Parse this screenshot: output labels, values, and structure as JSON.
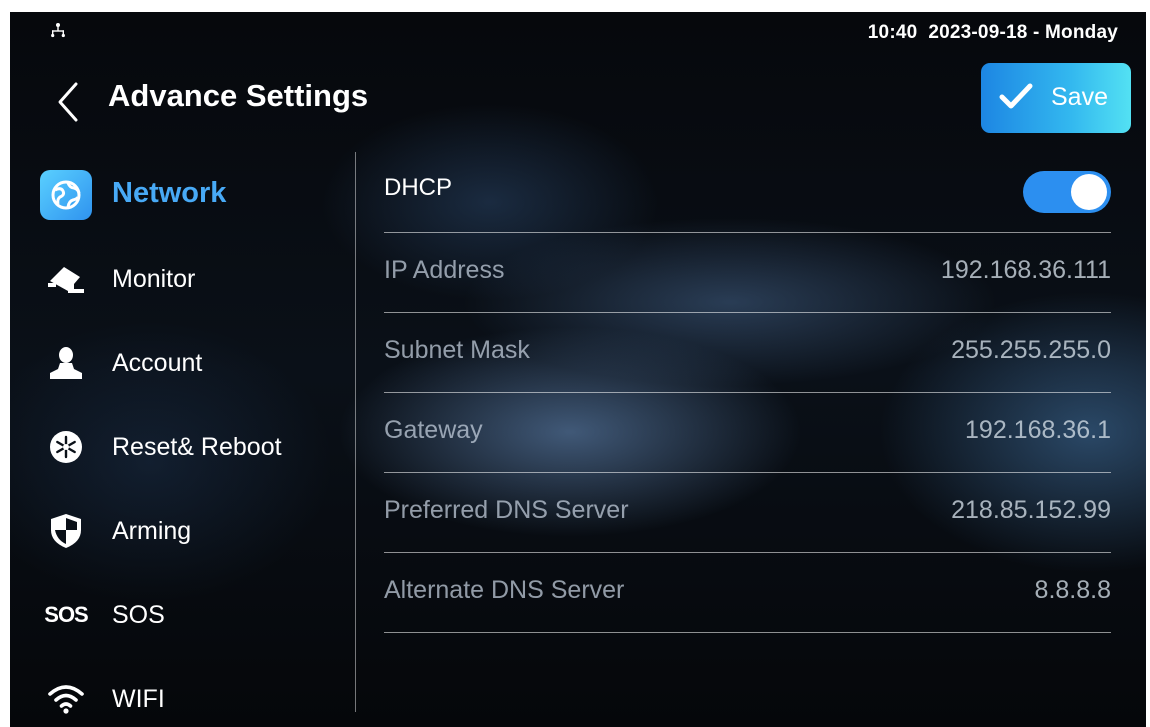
{
  "status_bar": {
    "clock": "10:40  2023-09-18 - Monday",
    "network_icon": "network-tree-icon"
  },
  "header": {
    "back_icon": "chevron-left-icon",
    "title": "Advance Settings",
    "save_label": "Save",
    "save_icon": "checkmark-icon"
  },
  "sidebar": {
    "items": [
      {
        "label": "Network",
        "icon": "network-globe-icon",
        "active": true
      },
      {
        "label": "Monitor",
        "icon": "camera-icon",
        "active": false
      },
      {
        "label": "Account",
        "icon": "person-icon",
        "active": false
      },
      {
        "label": "Reset& Reboot",
        "icon": "snowflake-icon",
        "active": false
      },
      {
        "label": "Arming",
        "icon": "shield-icon",
        "active": false
      },
      {
        "label": "SOS",
        "icon": "sos-icon",
        "icon_text": "SOS",
        "active": false
      },
      {
        "label": "WIFI",
        "icon": "wifi-icon",
        "active": false
      }
    ]
  },
  "network": {
    "dhcp": {
      "label": "DHCP",
      "enabled": true
    },
    "fields": [
      {
        "label": "IP Address",
        "value": "192.168.36.111"
      },
      {
        "label": "Subnet Mask",
        "value": "255.255.255.0"
      },
      {
        "label": "Gateway",
        "value": "192.168.36.1"
      },
      {
        "label": "Preferred DNS Server",
        "value": "218.85.152.99"
      },
      {
        "label": "Alternate DNS Server",
        "value": "8.8.8.8"
      }
    ]
  },
  "colors": {
    "accent": "#48aaf6",
    "save_gradient_start": "#1d86e3",
    "save_gradient_end": "#53e1f3",
    "toggle_on": "#2c8ff0"
  }
}
